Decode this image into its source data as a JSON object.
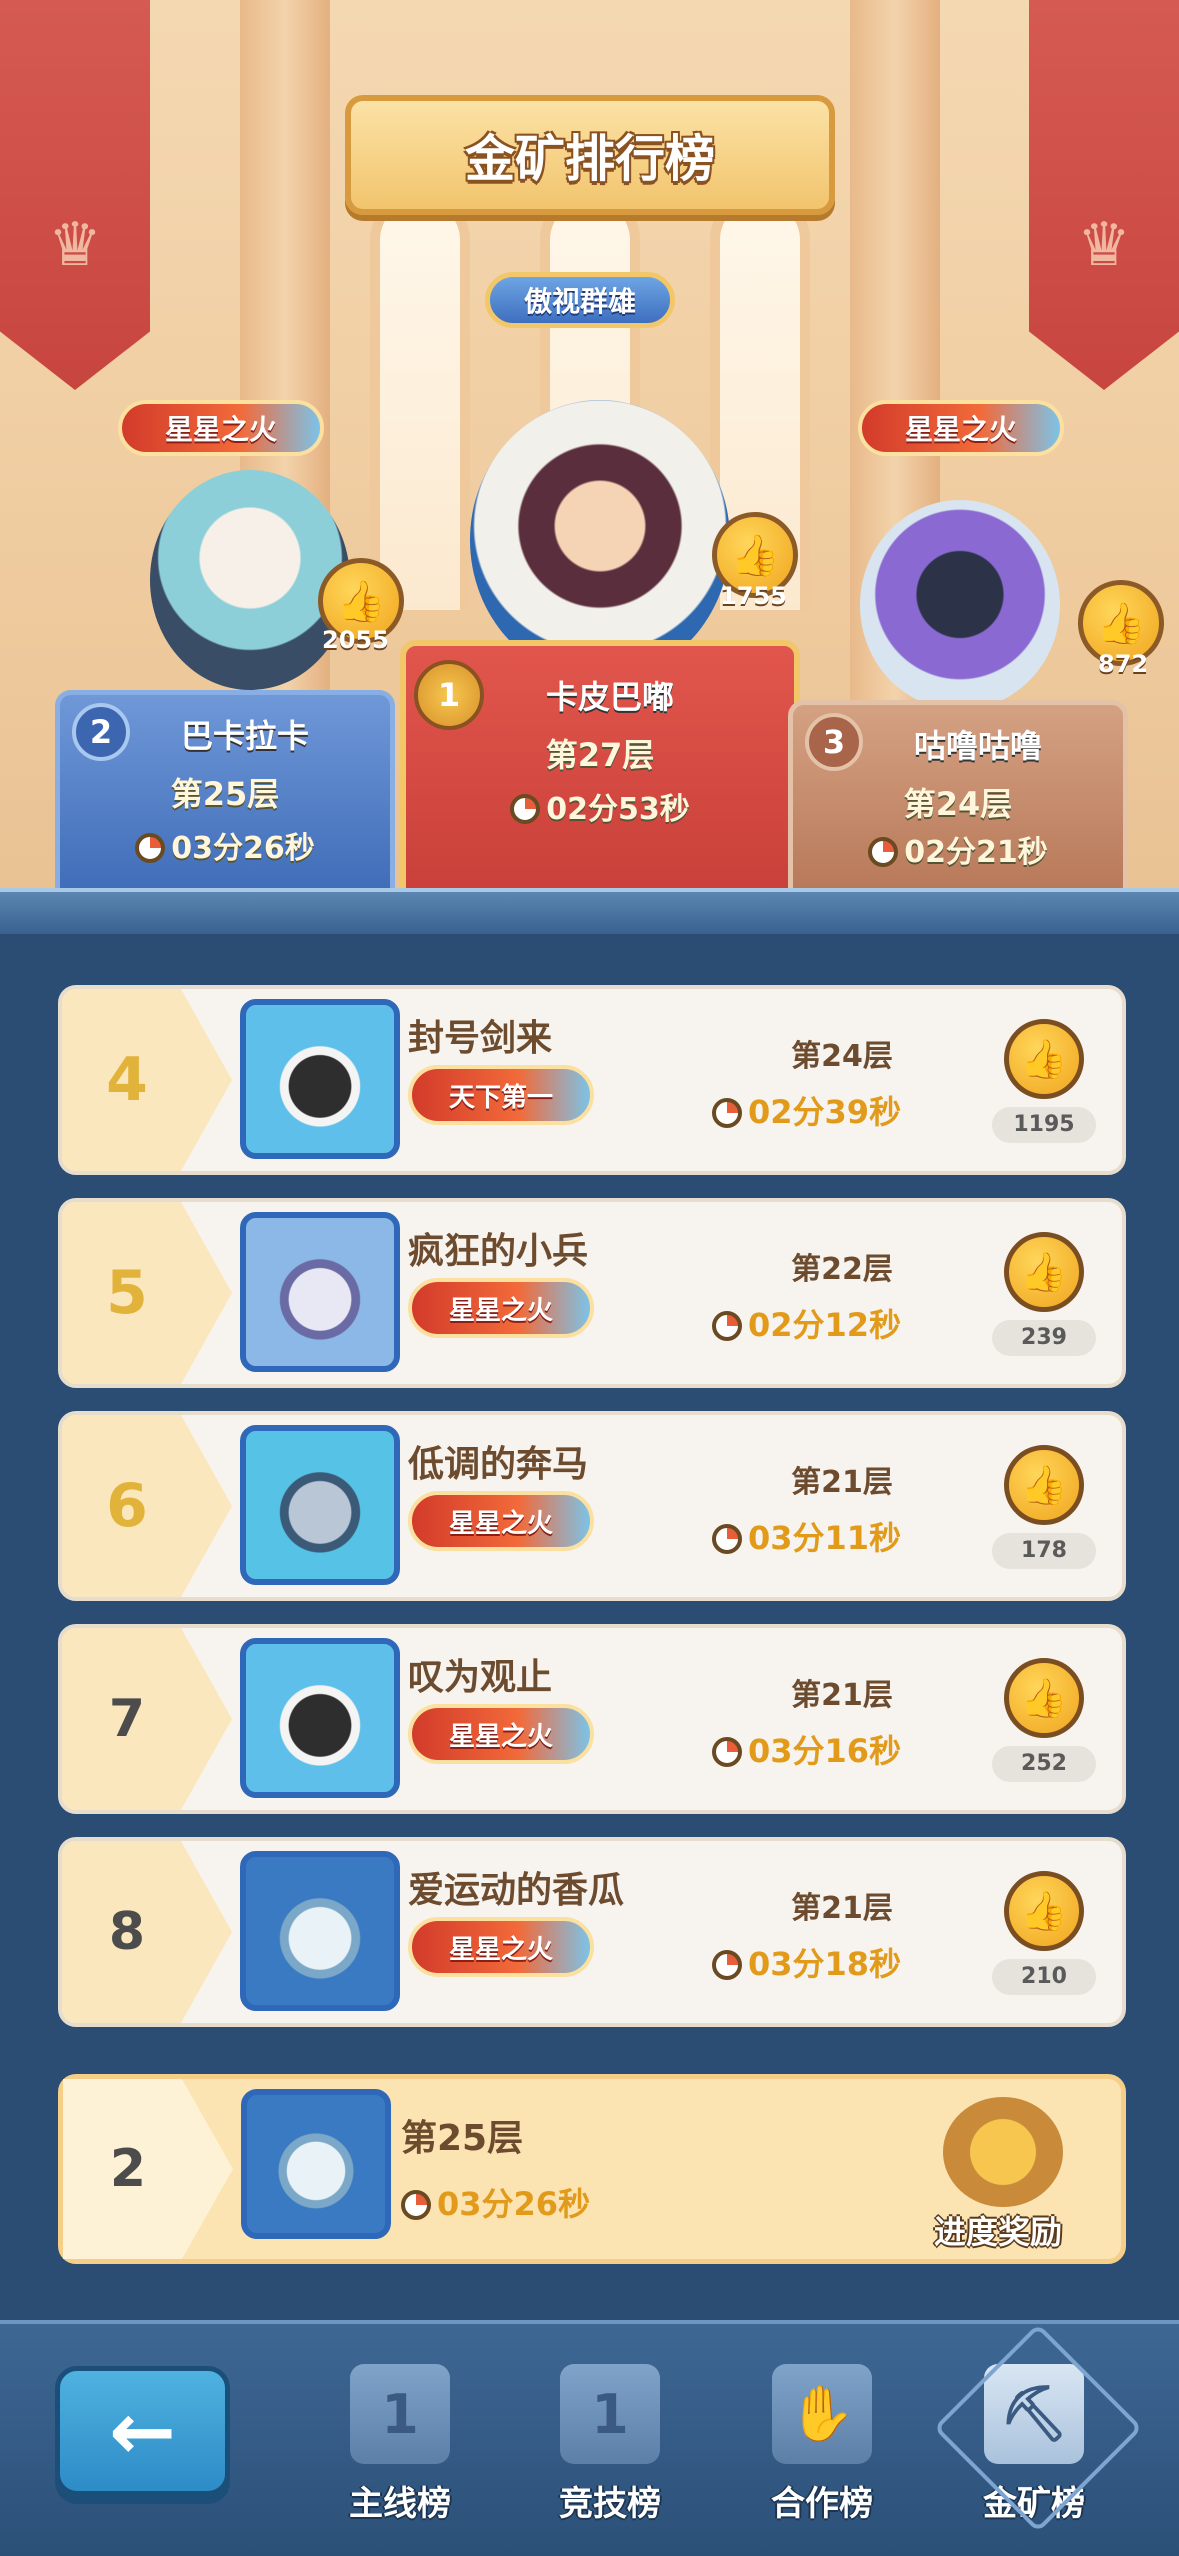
{
  "header": {
    "title": "金矿排行榜",
    "center_badge": "傲视群雄"
  },
  "podium": [
    {
      "rank": "1",
      "name": "卡皮巴嘟",
      "floor": "第27层",
      "time": "02分53秒",
      "likes": "1755",
      "badge": null
    },
    {
      "rank": "2",
      "name": "巴卡拉卡",
      "floor": "第25层",
      "time": "03分26秒",
      "likes": "2055",
      "badge": "星星之火"
    },
    {
      "rank": "3",
      "name": "咕噜咕噜",
      "floor": "第24层",
      "time": "02分21秒",
      "likes": "872",
      "badge": "星星之火"
    }
  ],
  "rows": [
    {
      "rank": "4",
      "name": "封号剑来",
      "badge": "天下第一",
      "floor": "第24层",
      "time": "02分39秒",
      "likes": "1195"
    },
    {
      "rank": "5",
      "name": "疯狂的小兵",
      "badge": "星星之火",
      "floor": "第22层",
      "time": "02分12秒",
      "likes": "239"
    },
    {
      "rank": "6",
      "name": "低调的奔马",
      "badge": "星星之火",
      "floor": "第21层",
      "time": "03分11秒",
      "likes": "178"
    },
    {
      "rank": "7",
      "name": "叹为观止",
      "badge": "星星之火",
      "floor": "第21层",
      "time": "03分16秒",
      "likes": "252"
    },
    {
      "rank": "8",
      "name": "爱运动的香瓜",
      "badge": "星星之火",
      "floor": "第21层",
      "time": "03分18秒",
      "likes": "210"
    }
  ],
  "me": {
    "rank": "2",
    "floor": "第25层",
    "time": "03分26秒",
    "reward_label": "进度奖励"
  },
  "nav": {
    "back_icon": "←",
    "tabs": [
      {
        "label": "主线榜",
        "icon": "1"
      },
      {
        "label": "竞技榜",
        "icon": "1"
      },
      {
        "label": "合作榜",
        "icon": "handshake-icon"
      },
      {
        "label": "金矿榜",
        "icon": "mine-cart-icon"
      }
    ]
  },
  "colors": {
    "gold": "#e29a1b",
    "panel": "#2b4d73",
    "row": "#f7f4ef",
    "podium_first": "#d2453e",
    "podium_second": "#3f6cb8",
    "podium_third": "#b77858"
  }
}
